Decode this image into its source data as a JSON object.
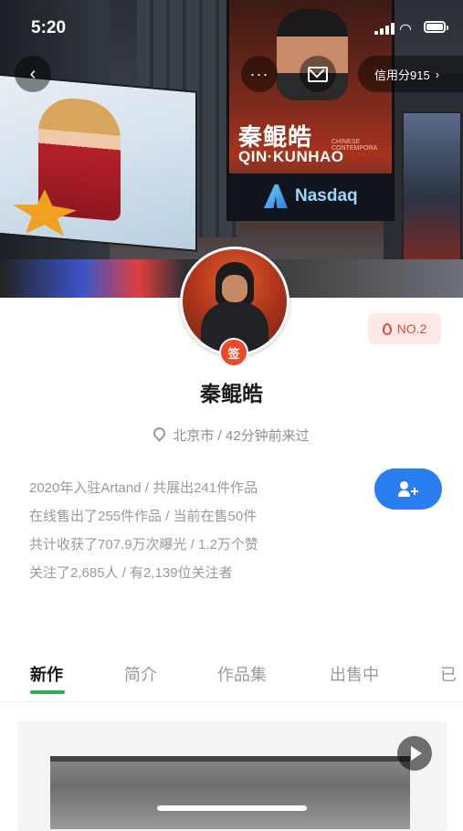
{
  "status_bar": {
    "time": "5:20"
  },
  "cover": {
    "billboard_name_cn": "秦鲲皓",
    "billboard_name_en": "QIN·KUNHAO",
    "billboard_subtitle": "CHINESE CONTEMPORA",
    "billboard_brand": "Nasdaq"
  },
  "nav": {
    "back_icon": "chevron-left-icon",
    "more_label": "···",
    "mail_icon": "mail-icon",
    "credit_label": "信用分915",
    "credit_chevron": "›"
  },
  "profile": {
    "name": "秦鲲皓",
    "seal_text": "签",
    "rank_label": "NO.2",
    "location": "北京市 / 42分钟前来过",
    "stats": [
      "2020年入驻Artand / 共展出241件作品",
      "在线售出了255件作品 / 当前在售50件",
      "共计收获了707.9万次曝光 / 1.2万个赞",
      "关注了2,685人 / 有2,139位关注者"
    ],
    "follow_icon": "add-user-icon"
  },
  "tabs": [
    {
      "label": "新作",
      "active": true
    },
    {
      "label": "简介",
      "active": false
    },
    {
      "label": "作品集",
      "active": false
    },
    {
      "label": "出售中",
      "active": false
    },
    {
      "label": "已",
      "active": false
    }
  ],
  "colors": {
    "accent_blue": "#2a7ff0",
    "tab_green": "#2bb24c",
    "rank_red": "#e2473a",
    "seal_red": "#ee4a2a"
  }
}
